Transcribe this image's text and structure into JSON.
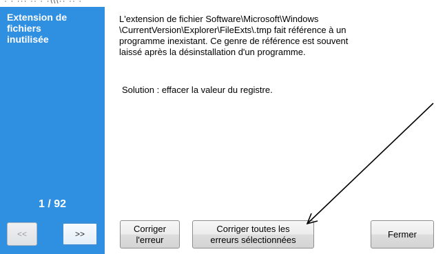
{
  "top_strip_text": "· · ··· ·· · ·\\\\\\·· ·· ·",
  "sidebar": {
    "title": "Extension de\nfichiers\ninutilisée",
    "counter": "1 / 92",
    "prev_label": "<<",
    "next_label": ">>"
  },
  "main": {
    "message": "L'extension de fichier Software\\Microsoft\\Windows\n\\CurrentVersion\\Explorer\\FileExts\\.tmp fait référence à un\nprogramme inexistant. Ce genre de référence est souvent\nlaissé après la désinstallation d'un programme.",
    "solution": "Solution : effacer la valeur du registre."
  },
  "buttons": {
    "fix_label": "Corriger\nl'erreur",
    "fix_all_label": "Corriger toutes les\nerreurs sélectionnées",
    "close_label": "Fermer"
  },
  "colors": {
    "sidebar_bg": "#2f8fe0",
    "sidebar_text": "#ffffff",
    "annotation_arrow": "#000000"
  },
  "icons": {
    "annotation": "arrow-annotation"
  }
}
